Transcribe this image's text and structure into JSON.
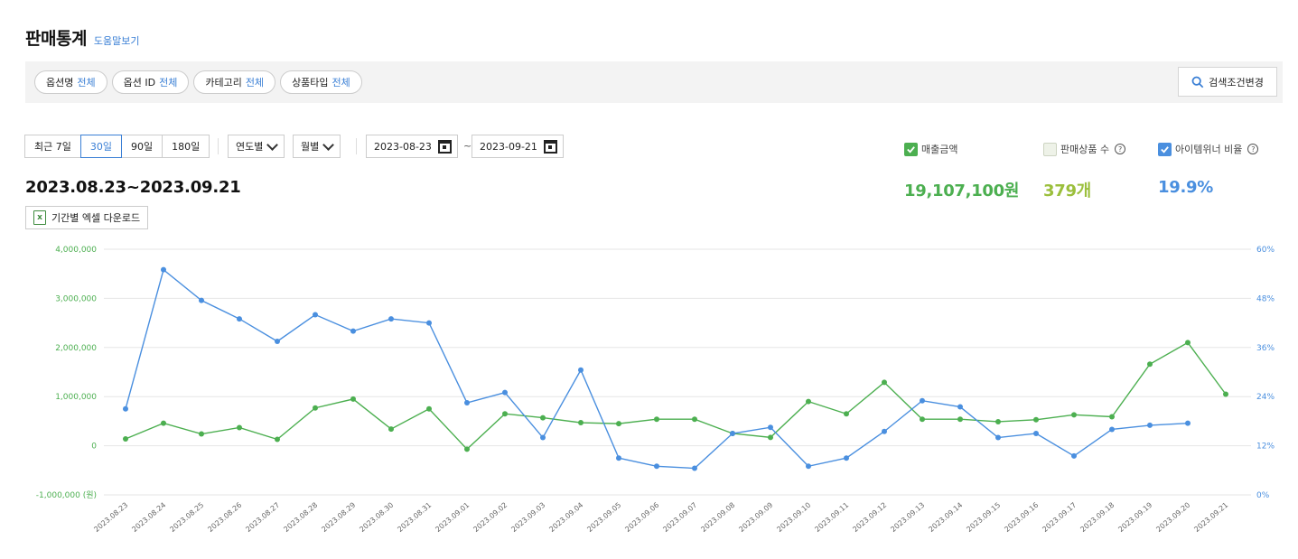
{
  "header": {
    "title": "판매통계",
    "help": "도움말보기"
  },
  "filters": [
    {
      "label": "옵션명",
      "value": "전체"
    },
    {
      "label": "옵션 ID",
      "value": "전체"
    },
    {
      "label": "카테고리",
      "value": "전체"
    },
    {
      "label": "상품타입",
      "value": "전체"
    }
  ],
  "search_change": "검색조건변경",
  "ranges": [
    "최근 7일",
    "30일",
    "90일",
    "180일"
  ],
  "active_range": "30일",
  "selects": {
    "yearly": "연도별",
    "monthly": "월별"
  },
  "dates": {
    "start": "2023-08-23",
    "end": "2023-09-21",
    "sep": "~"
  },
  "period_label": "2023.08.23~2023.09.21",
  "excel_download": "기간별 엑셀 다운로드",
  "legend": {
    "sales": {
      "label": "매출금액",
      "checked": true,
      "color": "#4caf50",
      "value": "19,107,100원"
    },
    "items": {
      "label": "판매상품 수",
      "checked": false,
      "color": "#9bbf3c",
      "value": "379개"
    },
    "winner": {
      "label": "아이템위너 비율",
      "checked": true,
      "color": "#4a8fdf",
      "value": "19.9%"
    }
  },
  "chart_data": {
    "type": "line",
    "x": [
      "2023.08.23",
      "2023.08.24",
      "2023.08.25",
      "2023.08.26",
      "2023.08.27",
      "2023.08.28",
      "2023.08.29",
      "2023.08.30",
      "2023.08.31",
      "2023.09.01",
      "2023.09.02",
      "2023.09.03",
      "2023.09.04",
      "2023.09.05",
      "2023.09.06",
      "2023.09.07",
      "2023.09.08",
      "2023.09.09",
      "2023.09.10",
      "2023.09.11",
      "2023.09.12",
      "2023.09.13",
      "2023.09.14",
      "2023.09.15",
      "2023.09.16",
      "2023.09.17",
      "2023.09.18",
      "2023.09.19",
      "2023.09.20",
      "2023.09.21"
    ],
    "left_axis": {
      "ticks": [
        "4,000,000",
        "3,000,000",
        "2,000,000",
        "1,000,000",
        "0",
        "-1,000,000 (원)"
      ],
      "ylim": [
        -1000000,
        4000000
      ]
    },
    "right_axis": {
      "ticks": [
        "60%",
        "48%",
        "36%",
        "24%",
        "12%",
        "0%"
      ],
      "ylim": [
        0,
        60
      ]
    },
    "series": [
      {
        "name": "매출금액",
        "axis": "left",
        "color": "#4caf50",
        "values": [
          140000,
          460000,
          240000,
          370000,
          130000,
          770000,
          950000,
          340000,
          750000,
          -70000,
          650000,
          570000,
          470000,
          450000,
          540000,
          540000,
          250000,
          170000,
          900000,
          650000,
          1290000,
          540000,
          540000,
          490000,
          530000,
          630000,
          590000,
          1660000,
          2100000,
          1050000
        ]
      },
      {
        "name": "아이템위너 비율",
        "axis": "right",
        "color": "#4a8fdf",
        "values": [
          21,
          55,
          47.5,
          43,
          37.5,
          44,
          40,
          43,
          42,
          22.5,
          25,
          14,
          30.5,
          9,
          7,
          6.5,
          15,
          16.5,
          7,
          9,
          15.5,
          23,
          21.5,
          14,
          15,
          9.5,
          16,
          17,
          17.5,
          null
        ]
      }
    ]
  }
}
